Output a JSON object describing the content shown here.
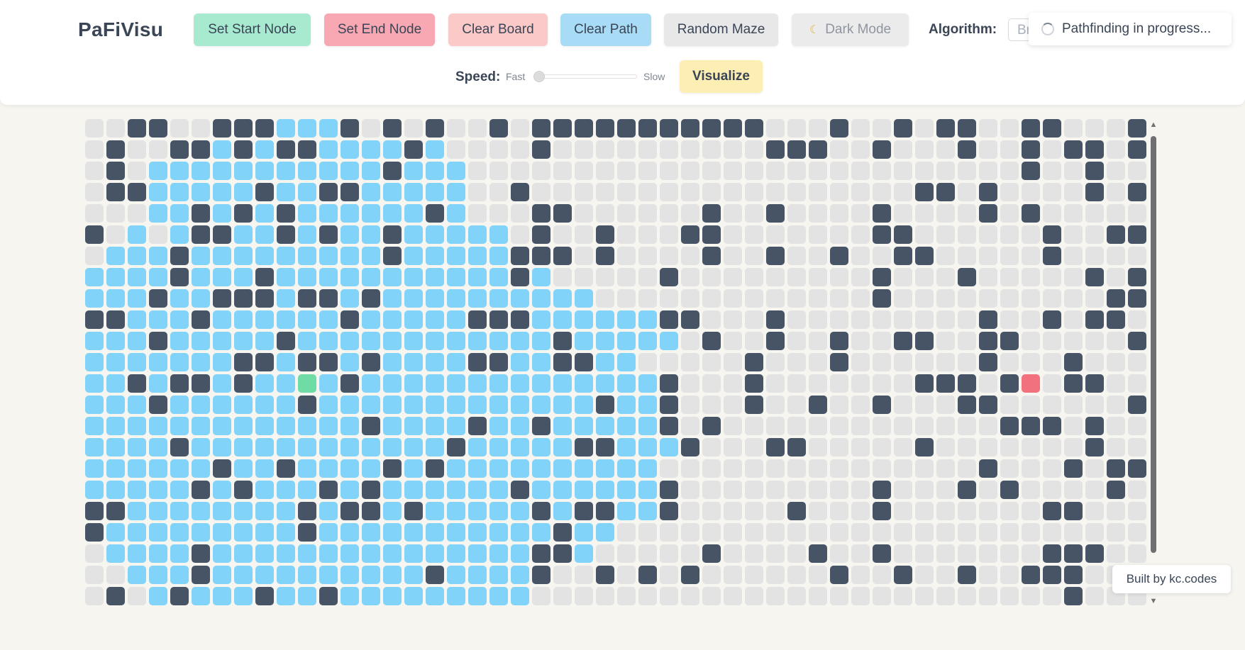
{
  "app": {
    "title": "PaFiVisu"
  },
  "toolbar": {
    "set_start": "Set Start Node",
    "set_end": "Set End Node",
    "clear_board": "Clear Board",
    "clear_path": "Clear Path",
    "random_maze": "Random Maze",
    "dark_mode": "Dark Mode",
    "dark_mode_icon": "moon-icon",
    "algorithm_label": "Algorithm:",
    "algorithm_value": "Breadth-First Search",
    "speed_label": "Speed:",
    "speed_fast": "Fast",
    "speed_slow": "Slow",
    "speed_value": 0,
    "visualize": "Visualize"
  },
  "status": {
    "toast": "Pathfinding in progress..."
  },
  "footer": {
    "credit": "Built by kc.codes"
  },
  "colors": {
    "empty": "#e3e3e3",
    "wall": "#475466",
    "visited": "#82d3f9",
    "start": "#6fdca6",
    "end": "#f2717f"
  },
  "grid": {
    "rows": 23,
    "cols": 50,
    "legend": {
      ".": "empty",
      "#": "wall",
      "v": "visited",
      "S": "start",
      "E": "end"
    },
    "cells": [
      "..##..###vvv#.#.#..#.###########...#..#.##..##...#",
      ".#..##v#v##vvvv#v....#..........###..#...#..#.##.#",
      ".#.vvvvvvvvvvv#vvv..........................#..#..",
      ".##vvvvv#vv##vvvvv..#..................##.#....#.#",
      "...vv#v#v#vvvvvv#v...##......#..#....#....#.#.....",
      "#.v.v##vv#v#vv#vvvvv.#..#...##.......##......#..##",
      ".vvv#vvvvvvvvv#vvvvv###.#....#..#..#..##.....#....",
      "vvvv#vvv#vvvvvvvvvvv#v.....#.........#...#.....#.#",
      "vvv#vv###v##v#vvvvvvvvvv.............#..........##",
      "##vvv#vvvvvv#vvvvv###vvvvvv##...#.........#..#.##.",
      "vvv#vvvvv#vvvvvvvvvvvv#vvvvv.#..#..#..##..##.....#",
      "vvvvvvv##v##v#vvvv##vv##vv.....#...#......#...#...",
      "vv#v##v#vvSv#vvvvvvvvvvvvvv#...#.......###.#E.##..",
      "vvv#vvvvvv#vvvvvvvvvvvvv#vv#...#..#..#...##......#",
      "vvvvvvvvvvvvv#vvvv#vv#vvvvv#.#.............###.#..",
      "vvvv#vvvvvvvvvvvv#vvvvv##vvv#...##.....#.......#..",
      "vvvvvv#vv#vvvv#v#vvvvvvvvvv...............#...#.##",
      "vvvvv#v#vvv#v#vvvvvv#vvvvvv#.........#...#.#....#.",
      "##vvvvvvvv#v##v#vvvvv#v##vv#.....#...#.......##...",
      "#vvvvvvvvv#vvvvvvvvvvv#vv.........................",
      ".vvvv#vvvvvvvvvvvvvvv##v.....#....#..#.......###..",
      "..vvv#vvvvvvvvvv#vvvv#..#.#.#......#..#..#..###...",
      ".#.v#vvv#vv#vvvvvvvvv.........................#..."
    ]
  }
}
